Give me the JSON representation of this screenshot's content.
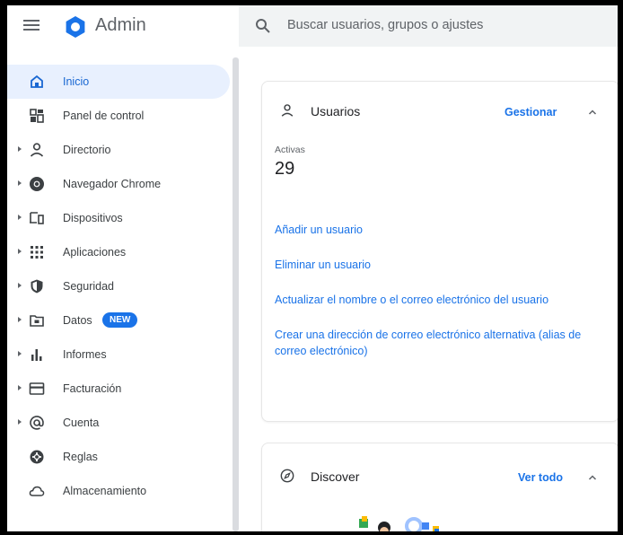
{
  "header": {
    "brand": "Admin",
    "search_placeholder": "Buscar usuarios, grupos o ajustes"
  },
  "sidebar": {
    "items": [
      {
        "label": "Inicio",
        "icon": "home-icon",
        "active": true,
        "expandable": false
      },
      {
        "label": "Panel de control",
        "icon": "dashboard-icon",
        "active": false,
        "expandable": false
      },
      {
        "label": "Directorio",
        "icon": "person-icon",
        "active": false,
        "expandable": true
      },
      {
        "label": "Navegador Chrome",
        "icon": "chrome-icon",
        "active": false,
        "expandable": true
      },
      {
        "label": "Dispositivos",
        "icon": "devices-icon",
        "active": false,
        "expandable": true
      },
      {
        "label": "Aplicaciones",
        "icon": "apps-grid-icon",
        "active": false,
        "expandable": true
      },
      {
        "label": "Seguridad",
        "icon": "shield-icon",
        "active": false,
        "expandable": true
      },
      {
        "label": "Datos",
        "icon": "folder-icon",
        "active": false,
        "expandable": true,
        "badge": "NEW"
      },
      {
        "label": "Informes",
        "icon": "bar-chart-icon",
        "active": false,
        "expandable": true
      },
      {
        "label": "Facturación",
        "icon": "credit-card-icon",
        "active": false,
        "expandable": true
      },
      {
        "label": "Cuenta",
        "icon": "at-sign-icon",
        "active": false,
        "expandable": true
      },
      {
        "label": "Reglas",
        "icon": "rules-icon",
        "active": false,
        "expandable": false
      },
      {
        "label": "Almacenamiento",
        "icon": "cloud-icon",
        "active": false,
        "expandable": false
      }
    ]
  },
  "users_card": {
    "title": "Usuarios",
    "action": "Gestionar",
    "stat_label": "Activas",
    "stat_value": "29",
    "links": [
      "Añadir un usuario",
      "Eliminar un usuario",
      "Actualizar el nombre o el correo electrónico del usuario",
      "Crear una dirección de correo electrónico alternativa (alias de correo electrónico)"
    ]
  },
  "discover_card": {
    "title": "Discover",
    "action": "Ver todo"
  },
  "colors": {
    "accent": "#1a73e8",
    "active_bg": "#e8f0fe",
    "search_bg": "#f1f3f4"
  }
}
